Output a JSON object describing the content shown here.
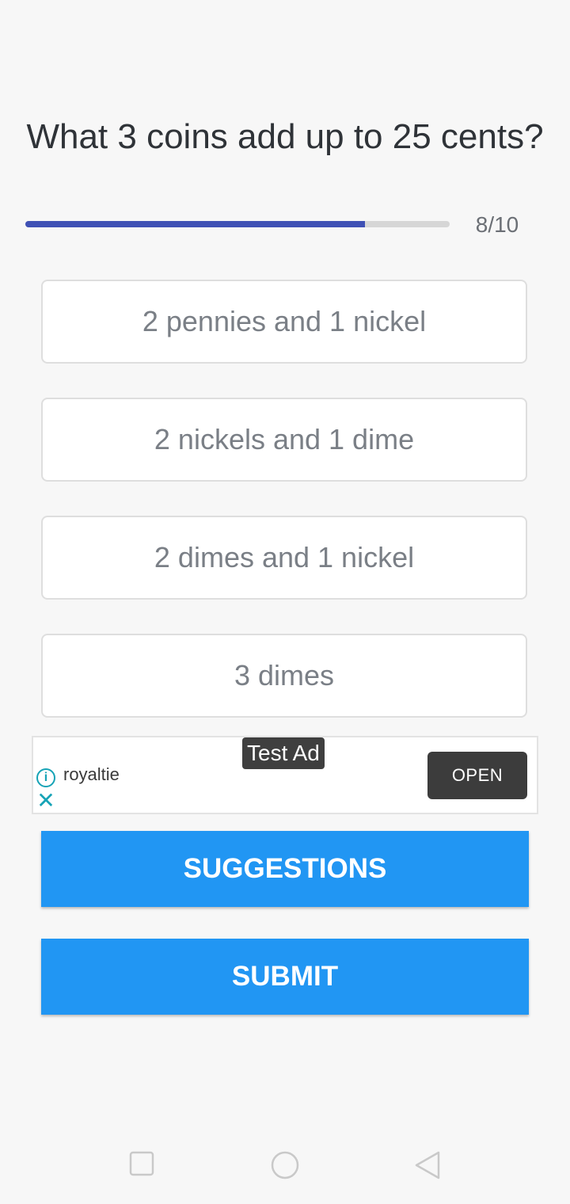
{
  "question": "What 3 coins add up to 25 cents?",
  "progress": {
    "text": "8/10",
    "current": 8,
    "total": 10,
    "fraction": 0.8
  },
  "options": [
    "2 pennies and 1 nickel",
    "2 nickels and 1 dime",
    "2 dimes and 1 nickel",
    "3 dimes"
  ],
  "ad": {
    "label": "Test Ad",
    "advertiser": "royaltie",
    "open_label": "OPEN",
    "info_icon": "info-icon",
    "close_icon": "close-icon"
  },
  "buttons": {
    "suggestions": "SUGGESTIONS",
    "submit": "SUBMIT"
  },
  "colors": {
    "accent": "#2196f3",
    "progress": "#3f51b5",
    "ad_icon": "#16a3b6"
  },
  "navbar": {
    "icons": [
      "square-recents-icon",
      "circle-home-icon",
      "triangle-back-icon"
    ]
  }
}
